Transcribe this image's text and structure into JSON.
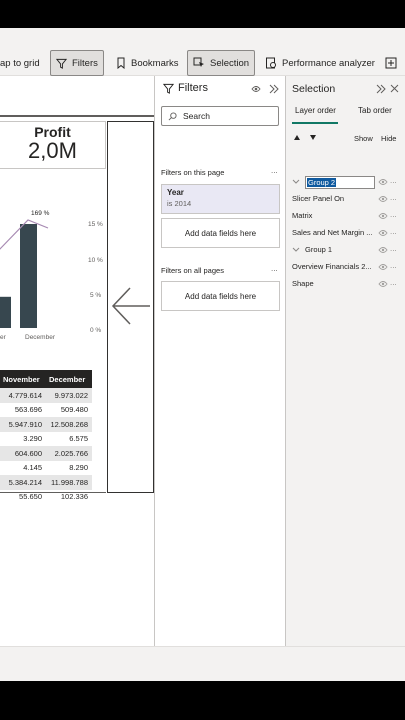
{
  "ribbon": {
    "snap_label": "ap to grid",
    "filters_label": "Filters",
    "bookmarks_label": "Bookmarks",
    "selection_label": "Selection",
    "performance_label": "Performance analyzer"
  },
  "canvas": {
    "profit_title": "Profit",
    "profit_value": "2,0M",
    "matrix_headers": [
      "November",
      "December"
    ],
    "matrix_rows": [
      [
        "4.779.614",
        "9.973.022"
      ],
      [
        "563.696",
        "509.480"
      ],
      [
        "5.947.910",
        "12.508.268"
      ],
      [
        "3.290",
        "6.575"
      ],
      [
        "604.600",
        "2.025.766"
      ],
      [
        "4.145",
        "8.290"
      ],
      [
        "5.384.214",
        "11.998.788"
      ],
      [
        "55.650",
        "102.336"
      ]
    ]
  },
  "chart_data": {
    "type": "bar",
    "categories": [
      "er",
      "December"
    ],
    "values": [
      30,
      100
    ],
    "secondary_axis_ticks": [
      "15 %",
      "10 %",
      "5 %",
      "0 %"
    ],
    "data_labels": [
      "169 %"
    ],
    "colors": {
      "bar": "#37474f",
      "line": "#a78ab2"
    }
  },
  "filters_pane": {
    "title": "Filters",
    "search_placeholder": "Search",
    "this_page_label": "Filters on this page",
    "year_card_title": "Year",
    "year_card_value": "is 2014",
    "add_fields_label": "Add data fields here",
    "all_pages_label": "Filters on all pages",
    "add_fields_label_2": "Add data fields here",
    "more": "..."
  },
  "selection_pane": {
    "title": "Selection",
    "tab_layer": "Layer order",
    "tab_tab": "Tab order",
    "show_label": "Show",
    "hide_label": "Hide",
    "layers": [
      {
        "name": "Group 2",
        "indent": 1,
        "selected": true
      },
      {
        "name": "Slicer Panel On",
        "indent": 0
      },
      {
        "name": "Matrix",
        "indent": 0
      },
      {
        "name": "Sales and Net Margin ...",
        "indent": 0
      },
      {
        "name": "Group 1",
        "indent": 1
      },
      {
        "name": "Overview Financials 2...",
        "indent": 0
      },
      {
        "name": "Shape",
        "indent": 0
      }
    ],
    "more": "..."
  },
  "colors": {
    "accent": "#117865",
    "selection": "#0f5a9f",
    "year_card": "#e9e8f4"
  }
}
